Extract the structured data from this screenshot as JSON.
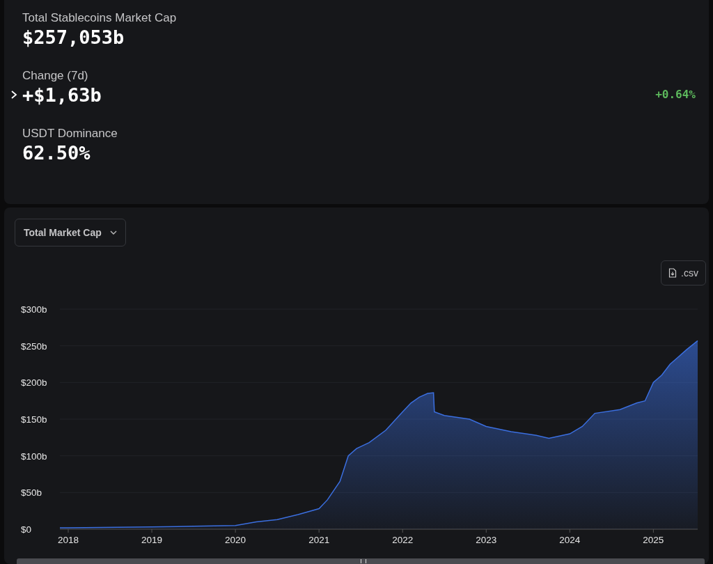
{
  "summary": [
    {
      "label": "Total Stablecoins Market Cap",
      "value": "$257,053b"
    },
    {
      "label": "Change (7d)",
      "value": "+$1,63b",
      "change": "+0.64%",
      "expanded": false
    },
    {
      "label": "USDT Dominance",
      "value": "62.50%"
    }
  ],
  "chart_panel": {
    "metric_select": {
      "value": "Total Market Cap"
    },
    "csv_button": {
      "label": ".csv"
    },
    "chart_data": {
      "type": "area",
      "xlim": [
        2017.9,
        2025.53
      ],
      "ylim": [
        0,
        300
      ],
      "xticks": [
        2018,
        2019,
        2020,
        2021,
        2022,
        2023,
        2024,
        2025
      ],
      "yticks": [
        {
          "value": 0,
          "label": "$0"
        },
        {
          "value": 50,
          "label": "$50b"
        },
        {
          "value": 100,
          "label": "$100b"
        },
        {
          "value": 150,
          "label": "$150b"
        },
        {
          "value": 200,
          "label": "$200b"
        },
        {
          "value": 250,
          "label": "$250b"
        },
        {
          "value": 300,
          "label": "$300b"
        }
      ],
      "x": [
        2017.9,
        2018.0,
        2019.0,
        2019.5,
        2020.0,
        2020.25,
        2020.5,
        2020.75,
        2021.0,
        2021.1,
        2021.25,
        2021.35,
        2021.45,
        2021.6,
        2021.8,
        2022.0,
        2022.1,
        2022.2,
        2022.3,
        2022.37,
        2022.38,
        2022.5,
        2022.8,
        2023.0,
        2023.3,
        2023.6,
        2023.75,
        2024.0,
        2024.15,
        2024.3,
        2024.6,
        2024.8,
        2024.9,
        2025.0,
        2025.1,
        2025.2,
        2025.3,
        2025.4,
        2025.53
      ],
      "grid": true,
      "series": [
        {
          "color": "#3b6fe0",
          "values": [
            2,
            2,
            3,
            4,
            5,
            10,
            13,
            20,
            28,
            40,
            65,
            100,
            110,
            118,
            135,
            160,
            172,
            180,
            185,
            186,
            160,
            155,
            150,
            140,
            133,
            128,
            124,
            130,
            140,
            158,
            163,
            172,
            175,
            200,
            210,
            225,
            235,
            245,
            257
          ]
        }
      ]
    }
  }
}
